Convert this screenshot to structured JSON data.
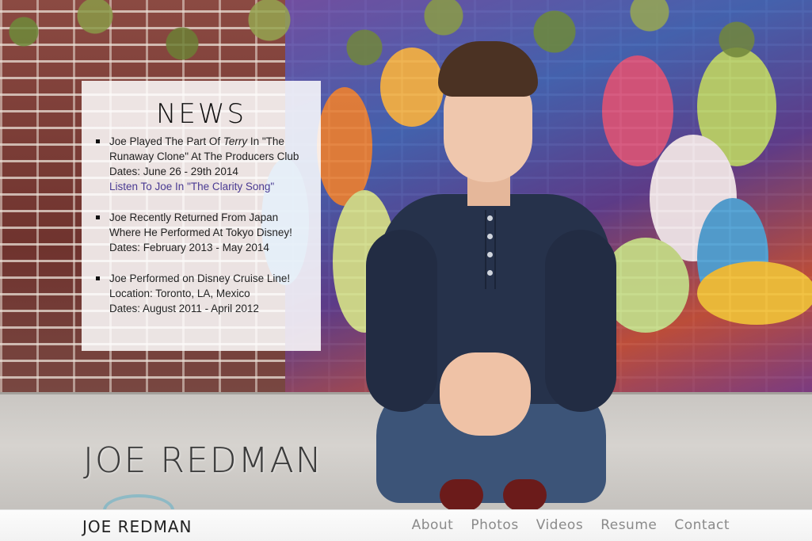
{
  "news": {
    "title": "NEWS",
    "items": [
      {
        "line1_prefix": "Joe Played The Part Of ",
        "line1_italic": "Terry",
        "line1_suffix": " In \"The",
        "line2": "Runaway Clone\" At The Producers Club",
        "line3": "Dates: June 26 - 29th 2014",
        "link": "Listen To Joe In \"The Clarity Song\""
      },
      {
        "line1": "Joe Recently Returned From Japan",
        "line2": "Where He Performed At Tokyo Disney!",
        "line3": "Dates: February 2013 - May 2014"
      },
      {
        "line1": "Joe Performed on Disney Cruise Line!",
        "line2": "Location: Toronto, LA, Mexico",
        "line3": "Dates: August 2011 - April 2012"
      }
    ]
  },
  "hero": {
    "name": "JOE REDMAN"
  },
  "nav": {
    "brand": "JOE REDMAN",
    "links": [
      "About",
      "Photos",
      "Videos",
      "Resume",
      "Contact"
    ]
  },
  "colors": {
    "link": "#4a3a92",
    "nav_text": "#8a8a8a",
    "panel_bg": "rgba(255,255,255,0.86)"
  }
}
